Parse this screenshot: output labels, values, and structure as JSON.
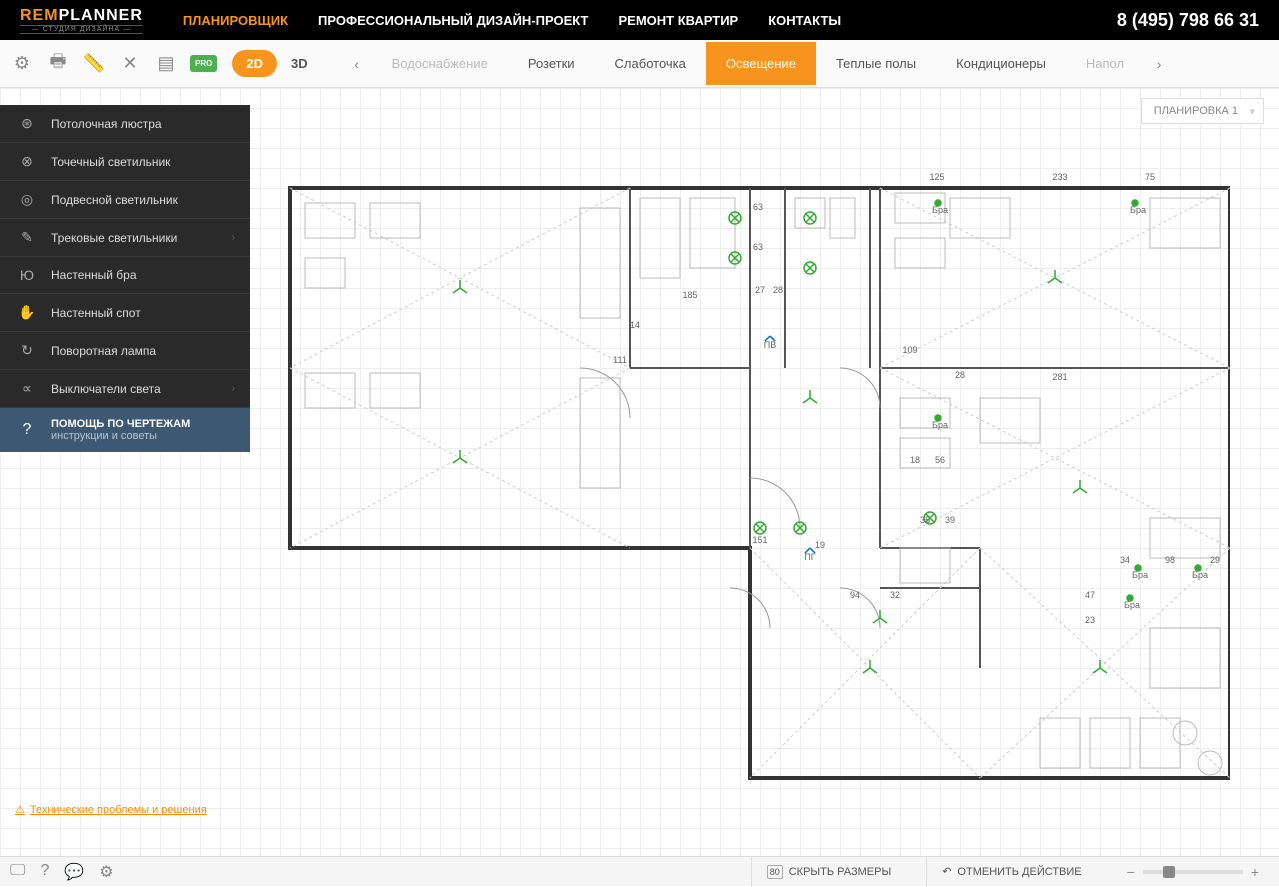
{
  "header": {
    "logo_rem": "REM",
    "logo_planner": "PLANNER",
    "logo_sub": "— СТУДИЯ ДИЗАЙНА —",
    "nav": [
      "ПЛАНИРОВЩИК",
      "ПРОФЕССИОНАЛЬНЫЙ ДИЗАЙН-ПРОЕКТ",
      "РЕМОНТ КВАРТИР",
      "КОНТАКТЫ"
    ],
    "phone": "8 (495) 798 66 31"
  },
  "toolbar": {
    "pro": "PRO",
    "view_2d": "2D",
    "view_3d": "3D",
    "tabs": [
      "Водоснабжение",
      "Розетки",
      "Слаботочка",
      "Освещение",
      "Теплые полы",
      "Кондиционеры",
      "Напол"
    ]
  },
  "layout_dropdown": "ПЛАНИРОВКА 1",
  "sidebar": {
    "items": [
      {
        "label": "Потолочная люстра",
        "arrow": false
      },
      {
        "label": "Точечный светильник",
        "arrow": false
      },
      {
        "label": "Подвесной светильник",
        "arrow": false
      },
      {
        "label": "Трековые светильники",
        "arrow": true
      },
      {
        "label": "Настенный бра",
        "arrow": false
      },
      {
        "label": "Настенный спот",
        "arrow": false
      },
      {
        "label": "Поворотная лампа",
        "arrow": false
      },
      {
        "label": "Выключатели света",
        "arrow": true
      }
    ],
    "help_title": "ПОМОЩЬ ПО ЧЕРТЕЖАМ",
    "help_sub": "инструкции и советы"
  },
  "dimensions": {
    "d125": "125",
    "d233": "233",
    "d75": "75",
    "d63a": "63",
    "d63b": "63",
    "d185": "185",
    "d27": "27",
    "d28": "28",
    "d14": "14",
    "d111": "111",
    "d109": "109",
    "d281": "281",
    "d28b": "28",
    "d18": "18",
    "d56": "56",
    "d35": "35",
    "d39": "39",
    "d151": "151",
    "d94": "94",
    "d32": "32",
    "d34": "34",
    "d98": "98",
    "d29": "29",
    "d47": "47",
    "d23": "23",
    "d19": "19",
    "bra": "Бра",
    "pv": "ПВ",
    "pg": "ПГ"
  },
  "tech_link": "Технические проблемы и решения",
  "footer": {
    "hide_dims": "СКРЫТЬ РАЗМЕРЫ",
    "undo": "ОТМЕНИТЬ ДЕЙСТВИЕ",
    "dims_badge": "80"
  }
}
